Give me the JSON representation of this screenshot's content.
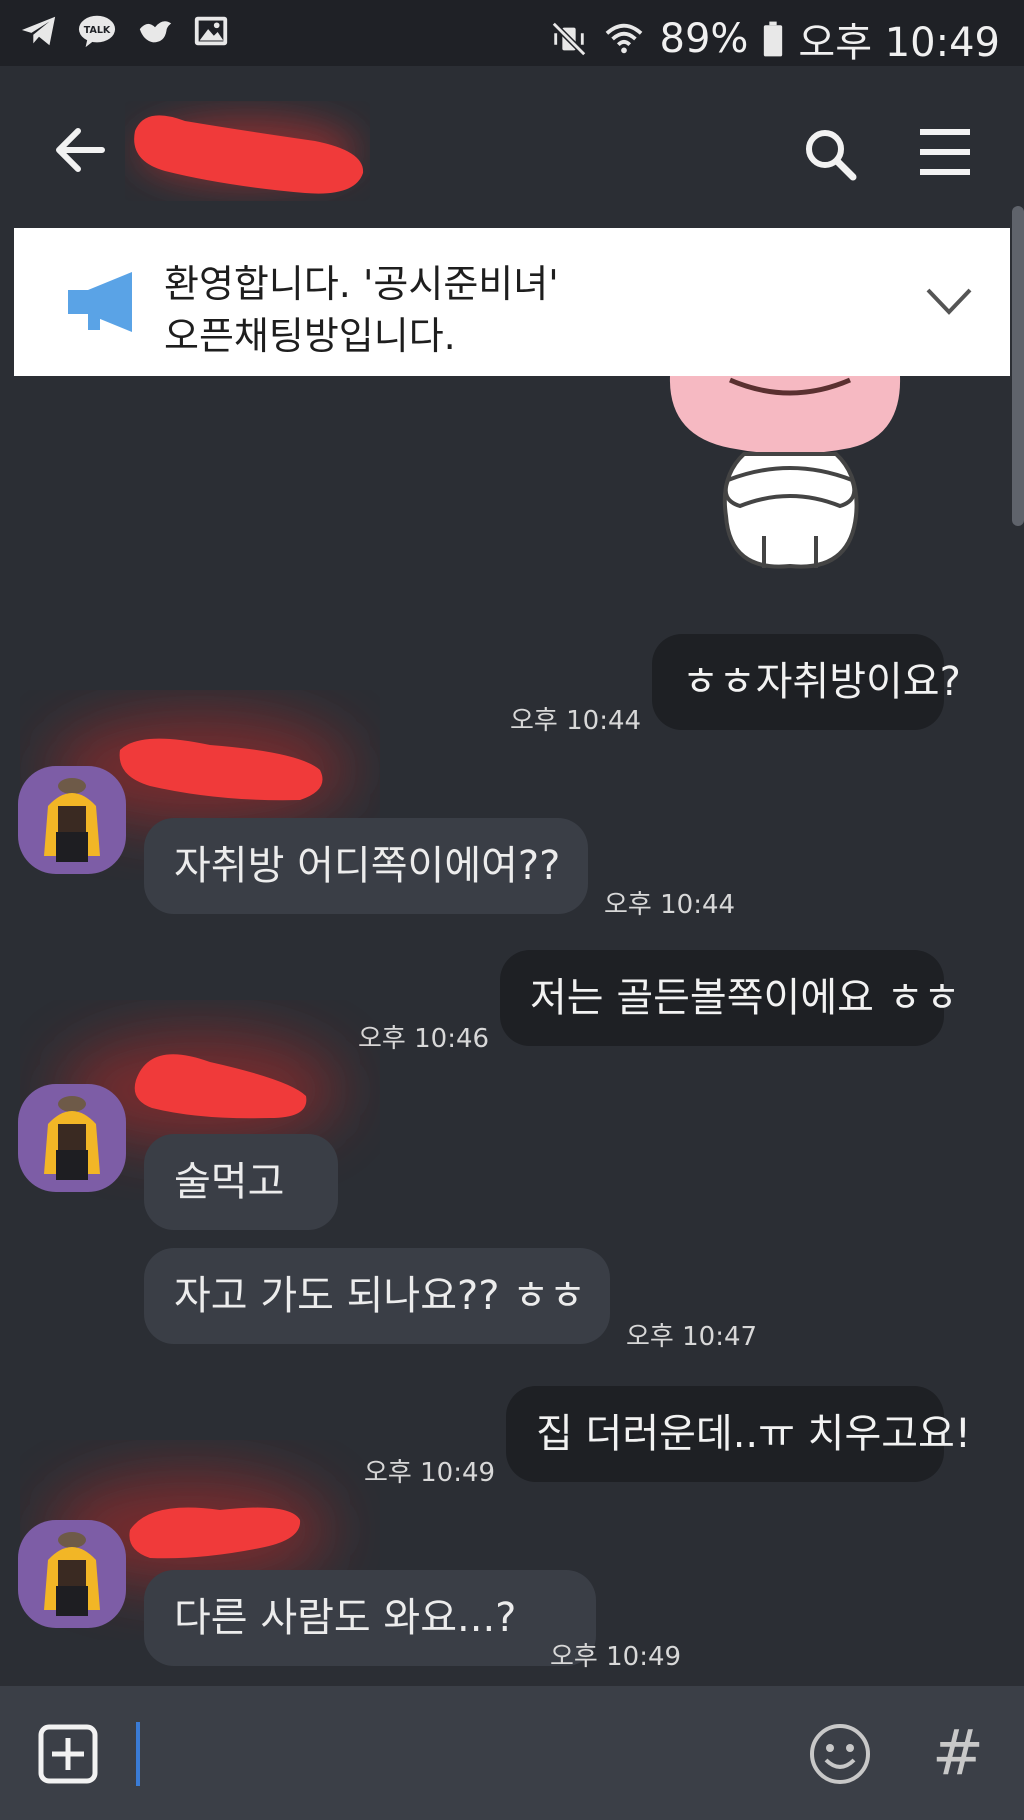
{
  "status_bar": {
    "battery": "89%",
    "time": "오후 10:49",
    "app_icons": [
      "telegram-icon",
      "kakaotalk-icon",
      "bird-icon",
      "gallery-icon"
    ],
    "talk_label": "TALK"
  },
  "header": {
    "back_icon": "back-arrow-icon",
    "search_icon": "search-icon",
    "menu_icon": "hamburger-menu-icon"
  },
  "notice": {
    "icon": "megaphone-icon",
    "text": "환영합니다. '공시준비녀'\n오픈채팅방입니다.",
    "expand_icon": "chevron-down-icon"
  },
  "messages": [
    {
      "side": "mine",
      "text": "ㅎㅎ자취방이요?",
      "time": "오후 10:44"
    },
    {
      "side": "theirs",
      "text": "자취방 어디쪽이에여??",
      "time": "오후 10:44"
    },
    {
      "side": "mine",
      "text": "저는 골든볼쪽이에요 ㅎㅎ",
      "time": "오후 10:46"
    },
    {
      "side": "theirs",
      "text": "술먹고",
      "time": ""
    },
    {
      "side": "theirs",
      "text": "자고 가도 되나요?? ㅎㅎ",
      "time": "오후 10:47"
    },
    {
      "side": "mine",
      "text": "집 더러운데..ㅠ 치우고요!",
      "time": "오후 10:49"
    },
    {
      "side": "theirs",
      "text": "다른 사람도 와요...?",
      "time": "오후 10:49"
    }
  ],
  "input_bar": {
    "add_icon": "plus-square-icon",
    "emoji_icon": "emoji-icon",
    "hash_label": "#"
  },
  "colors": {
    "background": "#2b2e34",
    "my_bubble": "#1e2024",
    "their_bubble": "#3a3e46",
    "redaction": "#f03a3a"
  }
}
